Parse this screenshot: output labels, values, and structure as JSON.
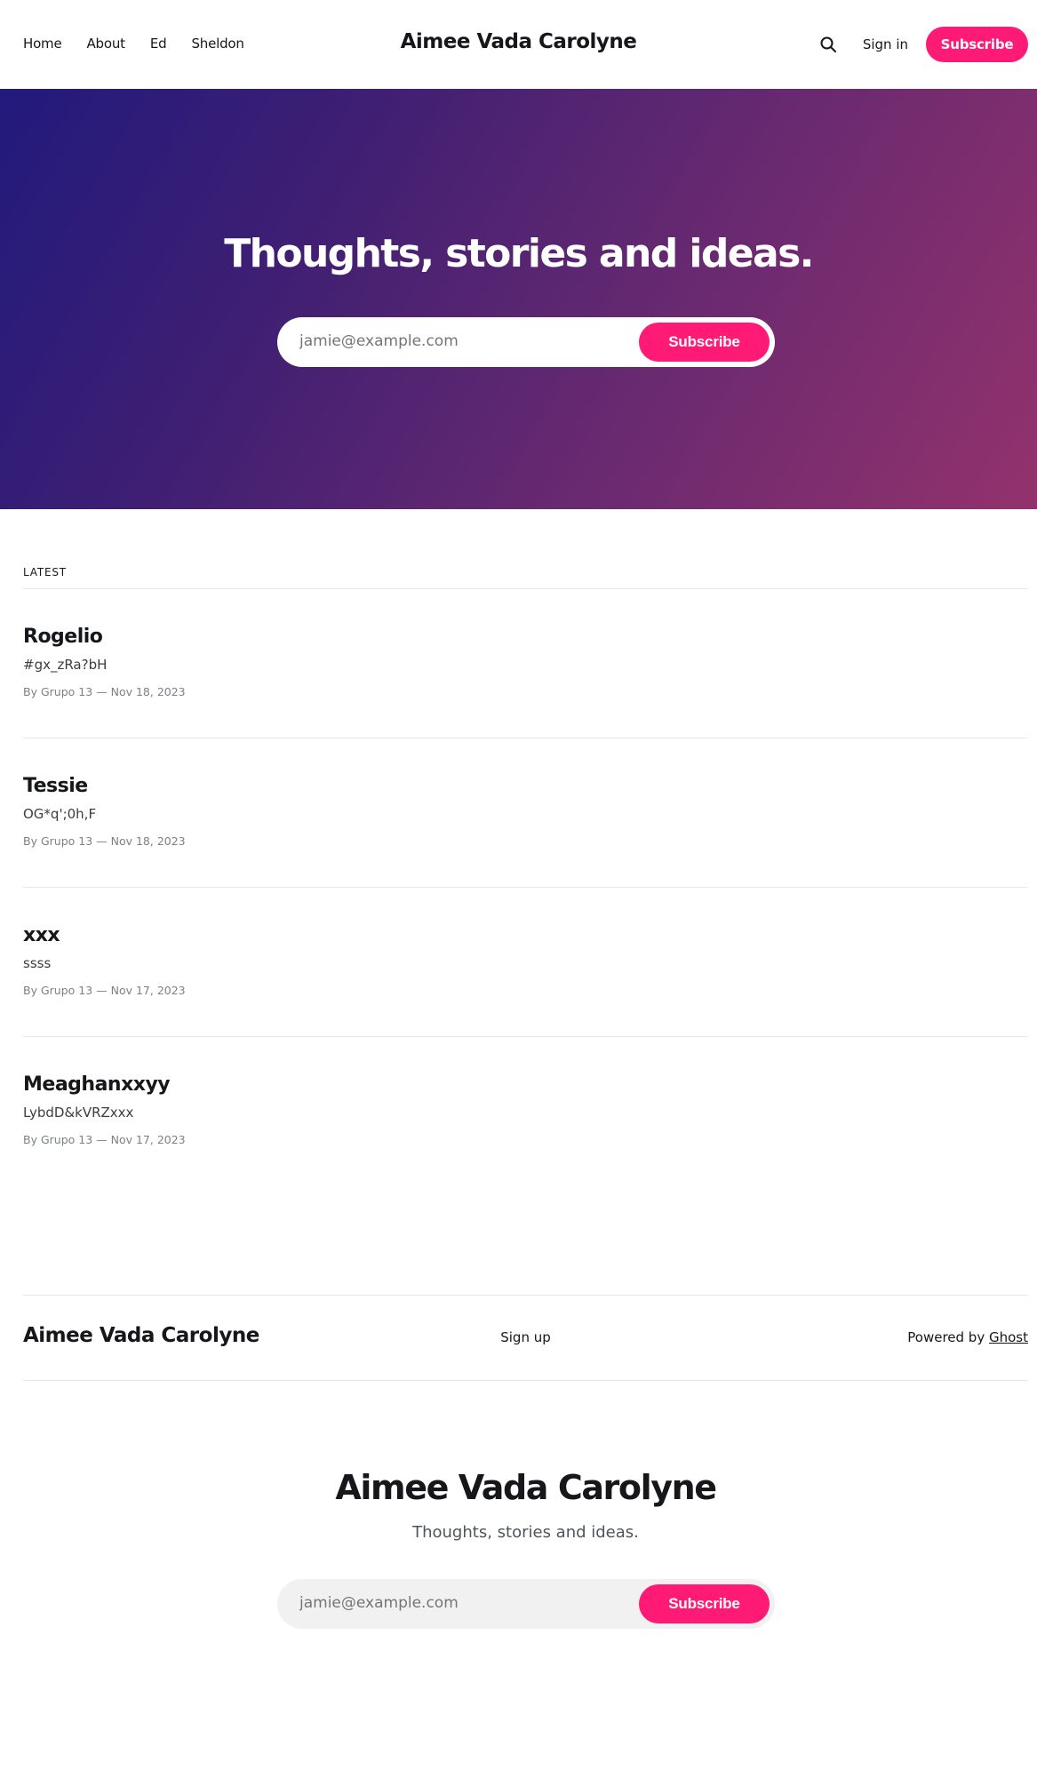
{
  "header": {
    "nav": [
      "Home",
      "About",
      "Ed",
      "Sheldon"
    ],
    "site_title": "Aimee Vada Carolyne",
    "signin_label": "Sign in",
    "subscribe_label": "Subscribe"
  },
  "hero": {
    "heading": "Thoughts, stories and ideas.",
    "email_placeholder": "jamie@example.com",
    "subscribe_label": "Subscribe"
  },
  "latest": {
    "label": "LATEST",
    "posts": [
      {
        "title": "Rogelio",
        "excerpt": "#gx_zRa?bH",
        "meta": "By Grupo 13 — Nov 18, 2023"
      },
      {
        "title": "Tessie",
        "excerpt": "OG*q';0h,F",
        "meta": "By Grupo 13 — Nov 18, 2023"
      },
      {
        "title": "xxx",
        "excerpt": "ssss",
        "meta": "By Grupo 13 — Nov 17, 2023"
      },
      {
        "title": "Meaghanxxyy",
        "excerpt": "LybdD&kVRZxxx",
        "meta": "By Grupo 13 — Nov 17, 2023"
      }
    ]
  },
  "footer": {
    "site_title": "Aimee Vada Carolyne",
    "signup_label": "Sign up",
    "powered_prefix": "Powered by ",
    "powered_link": "Ghost"
  },
  "cta": {
    "title": "Aimee Vada Carolyne",
    "subtitle": "Thoughts, stories and ideas.",
    "email_placeholder": "jamie@example.com",
    "subscribe_label": "Subscribe"
  },
  "colors": {
    "accent": "#ff1a75",
    "hero_gradient_start": "#211a7c",
    "hero_gradient_end": "#93326c"
  }
}
